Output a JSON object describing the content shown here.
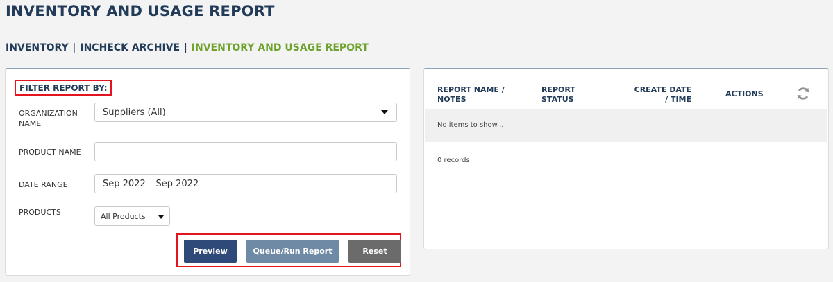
{
  "page": {
    "title": "INVENTORY AND USAGE REPORT"
  },
  "breadcrumb": {
    "items": [
      "INVENTORY",
      "INCHECK ARCHIVE",
      "INVENTORY AND USAGE REPORT"
    ],
    "separator": "|",
    "active_color": "#6ea22c"
  },
  "filter": {
    "heading": "FILTER REPORT BY:",
    "organization": {
      "label": "ORGANIZATION NAME",
      "value": "Suppliers (All)"
    },
    "product_name": {
      "label": "PRODUCT NAME",
      "value": ""
    },
    "date_range": {
      "label": "DATE RANGE",
      "value": "Sep 2022 – Sep 2022"
    },
    "products": {
      "label": "PRODUCTS",
      "value": "All Products"
    },
    "buttons": {
      "preview": "Preview",
      "queue": "Queue/Run Report",
      "reset": "Reset"
    }
  },
  "report_table": {
    "columns": [
      "REPORT NAME / NOTES",
      "REPORT STATUS",
      "CREATE DATE / TIME",
      "ACTIONS"
    ],
    "empty_message": "No items to show...",
    "record_count": "0 records",
    "refresh_icon": "refresh-icon"
  },
  "colors": {
    "brand_dark": "#223b58",
    "highlight_red": "#e3141e",
    "preview_button": "#2f4a78",
    "queue_button": "#6f8aa5",
    "reset_button": "#6b6b6b"
  }
}
